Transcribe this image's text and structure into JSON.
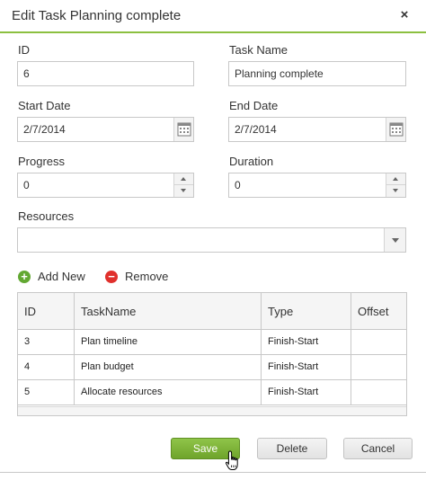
{
  "dialog": {
    "title": "Edit Task Planning complete",
    "close_glyph": "×"
  },
  "form": {
    "id": {
      "label": "ID",
      "value": "6"
    },
    "task_name": {
      "label": "Task Name",
      "value": "Planning complete"
    },
    "start_date": {
      "label": "Start Date",
      "value": "2/7/2014"
    },
    "end_date": {
      "label": "End Date",
      "value": "2/7/2014"
    },
    "progress": {
      "label": "Progress",
      "value": "0"
    },
    "duration": {
      "label": "Duration",
      "value": "0"
    },
    "resources": {
      "label": "Resources",
      "value": ""
    }
  },
  "toolbar": {
    "add_label": "Add New",
    "remove_label": "Remove",
    "add_glyph": "+",
    "remove_glyph": "−",
    "add_color": "#62a832",
    "remove_color": "#e0302c"
  },
  "grid": {
    "columns": [
      "ID",
      "TaskName",
      "Type",
      "Offset"
    ],
    "rows": [
      {
        "id": "3",
        "task_name": "Plan timeline",
        "type": "Finish-Start",
        "offset": ""
      },
      {
        "id": "4",
        "task_name": "Plan budget",
        "type": "Finish-Start",
        "offset": ""
      },
      {
        "id": "5",
        "task_name": "Allocate resources",
        "type": "Finish-Start",
        "offset": ""
      }
    ]
  },
  "buttons": {
    "save": "Save",
    "delete": "Delete",
    "cancel": "Cancel"
  },
  "colors": {
    "accent": "#8cc040",
    "save_button": "#7cb33a"
  },
  "icons": [
    "close-icon",
    "calendar-icon",
    "spin-up-icon",
    "spin-down-icon",
    "dropdown-arrow-icon",
    "plus-circle-icon",
    "minus-circle-icon",
    "hand-cursor-icon"
  ]
}
